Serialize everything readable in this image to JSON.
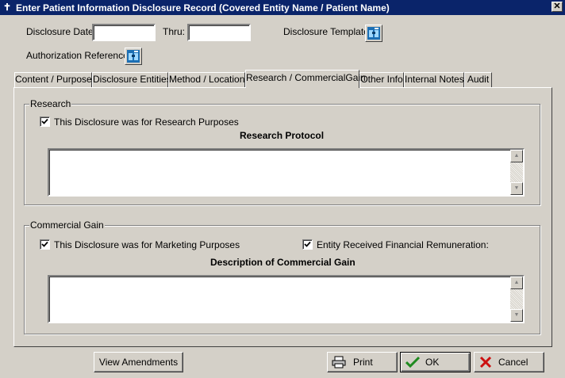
{
  "window": {
    "title": "Enter Patient Information Disclosure Record (Covered Entity Name / Patient Name)",
    "close_glyph": "✕"
  },
  "header": {
    "disclosure_date_label": "Disclosure Date:",
    "disclosure_date_value": "",
    "thru_label": "Thru:",
    "thru_value": "",
    "disclosure_template_label": "Disclosure Template:",
    "authorization_reference_label": "Authorization Reference:"
  },
  "tabs": [
    {
      "label": "Content / Purpose",
      "active": false
    },
    {
      "label": "Disclosure Entities",
      "active": false
    },
    {
      "label": "Method / Location",
      "active": false
    },
    {
      "label": "Research / CommercialGain",
      "active": true
    },
    {
      "label": "Other Info",
      "active": false
    },
    {
      "label": "Internal Notes",
      "active": false
    },
    {
      "label": "Audit",
      "active": false
    }
  ],
  "research": {
    "group_label": "Research",
    "checkbox_label": "This Disclosure was for Research Purposes",
    "checked": true,
    "protocol_heading": "Research Protocol",
    "protocol_text": ""
  },
  "commercial": {
    "group_label": "Commercial Gain",
    "marketing_label": "This Disclosure was for Marketing Purposes",
    "marketing_checked": true,
    "remuneration_label": "Entity Received Financial Remuneration:",
    "remuneration_checked": true,
    "description_heading": "Description of Commercial Gain",
    "description_text": ""
  },
  "buttons": {
    "view_amendments": "View Amendments",
    "print": "Print",
    "ok": "OK",
    "cancel": "Cancel"
  },
  "colors": {
    "title_bar": "#0a246a",
    "window_face": "#d4d0c8",
    "ok_check": "#1f8a1f",
    "cancel_x": "#cc1010"
  }
}
